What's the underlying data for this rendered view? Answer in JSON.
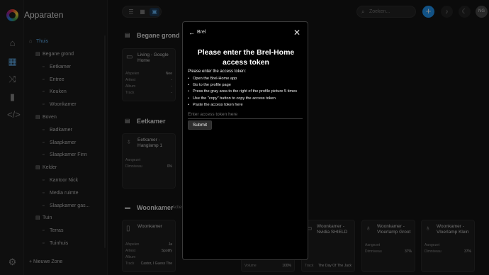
{
  "app": {
    "title": "Apparaten"
  },
  "rail": {
    "icons": [
      "home-icon",
      "grid-icon",
      "shuffle-icon",
      "bar-chart-icon",
      "code-icon",
      "gear-icon"
    ]
  },
  "sidebar": {
    "all_label": "Thuis",
    "items": [
      {
        "label": "Begane grond",
        "level": 0
      },
      {
        "label": "Eetkamer",
        "level": 1
      },
      {
        "label": "Entree",
        "level": 1
      },
      {
        "label": "Keuken",
        "level": 1
      },
      {
        "label": "Woonkamer",
        "level": 1
      },
      {
        "label": "Boven",
        "level": 0
      },
      {
        "label": "Badkamer",
        "level": 1
      },
      {
        "label": "Slaapkamer",
        "level": 1
      },
      {
        "label": "Slaapkamer Finn",
        "level": 1
      },
      {
        "label": "Kelder",
        "level": 0
      },
      {
        "label": "Kantoor Nick",
        "level": 1
      },
      {
        "label": "Media ruimte",
        "level": 1
      },
      {
        "label": "Slaapkamer gas...",
        "level": 1
      },
      {
        "label": "Tuin",
        "level": 0
      },
      {
        "label": "Terras",
        "level": 1
      },
      {
        "label": "Tuinhuis",
        "level": 1
      }
    ],
    "new_zone": "Nieuwe Zone"
  },
  "topbar": {
    "search_placeholder": "Zoeken...",
    "avatar_initials": "NG",
    "add_label": "+"
  },
  "background": {
    "sections": [
      {
        "title": "Begane grond",
        "sub": ""
      },
      {
        "title": "Eetkamer",
        "sub": ""
      },
      {
        "title": "Woonkamer",
        "sub": "Acties"
      }
    ],
    "cards": [
      {
        "name": "Living - Google Home",
        "rows": [
          [
            "Afspelen",
            "Nee"
          ],
          [
            "Artiest",
            "-"
          ],
          [
            "Album",
            "-"
          ],
          [
            "Track",
            "-"
          ]
        ]
      },
      {
        "name": "Eetkamer - Hanglamp 1",
        "rows": [
          [
            "Aangezet",
            ""
          ],
          [
            "Dimniveau",
            "0%"
          ]
        ]
      },
      {
        "name": "Woonkamer",
        "rows": [
          [
            "Afspelen",
            "Ja"
          ],
          [
            "Artiest",
            "Spotify"
          ],
          [
            "Album",
            ""
          ],
          [
            "Track",
            "Castor, I Guess The"
          ]
        ]
      },
      {
        "name": "",
        "rows": [
          [
            "Volume",
            "100%"
          ]
        ]
      },
      {
        "name": "Woonkamer - Nvidia SHIELD",
        "rows": [
          [
            "Track",
            "The Day Of The Jack"
          ]
        ]
      },
      {
        "name": "Woonkamer - Vloerlamp Groot",
        "rows": [
          [
            "Aangezet",
            ""
          ],
          [
            "Dimniveau",
            "37%"
          ]
        ]
      },
      {
        "name": "Woonkamer - Vloerlamp Klein",
        "rows": [
          [
            "Aangezet",
            ""
          ],
          [
            "Dimniveau",
            "37%"
          ]
        ]
      }
    ]
  },
  "modal": {
    "breadcrumb": "Brel",
    "title": "Please enter the Brel-Home access token",
    "intro": "Please enter the access token:",
    "steps": [
      "Open the Brel-Home app",
      "Go to the profile page",
      "Press the gray area to the right of the profile picture 5 times",
      "Use the \"copy\" button to copy the access token",
      "Paste the access token here"
    ],
    "input_placeholder": "Enter access token here",
    "input_value": "",
    "submit_label": "Submit"
  },
  "colors": {
    "accent": "#2196f3",
    "active_blue": "#64b5f6",
    "modal_bg": "#000000"
  }
}
